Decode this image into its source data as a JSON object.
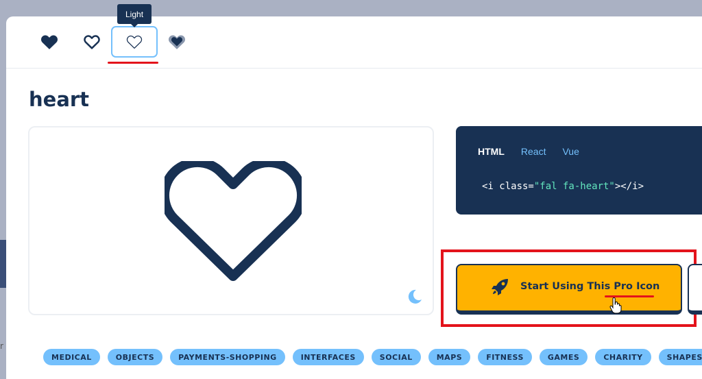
{
  "style_bar": {
    "items": [
      {
        "name": "solid",
        "icon": "heart-solid-icon"
      },
      {
        "name": "regular",
        "icon": "heart-regular-icon"
      },
      {
        "name": "light",
        "icon": "heart-light-icon",
        "active": true
      },
      {
        "name": "duotone",
        "icon": "heart-duotone-icon"
      }
    ],
    "tooltip": "Light"
  },
  "icon": {
    "title": "heart",
    "preview_icon": "heart-light-icon",
    "dark_mode_icon": "moon-icon"
  },
  "code": {
    "tabs": [
      "HTML",
      "React",
      "Vue"
    ],
    "active_tab": "HTML",
    "snippet_open": "<i class=",
    "snippet_class": "\"fal fa-heart\"",
    "snippet_close": "></i>"
  },
  "cta": {
    "label": "Start Using This Pro Icon",
    "icon": "rocket-icon"
  },
  "tags": [
    "MEDICAL",
    "OBJECTS",
    "PAYMENTS-SHOPPING",
    "INTERFACES",
    "SOCIAL",
    "MAPS",
    "FITNESS",
    "GAMES",
    "CHARITY",
    "SHAPES"
  ],
  "colors": {
    "navy": "#183153",
    "accent_blue": "#74c0fc",
    "cta_yellow": "#ffb200",
    "highlight_red": "#e3131b",
    "code_string": "#63e6be"
  }
}
